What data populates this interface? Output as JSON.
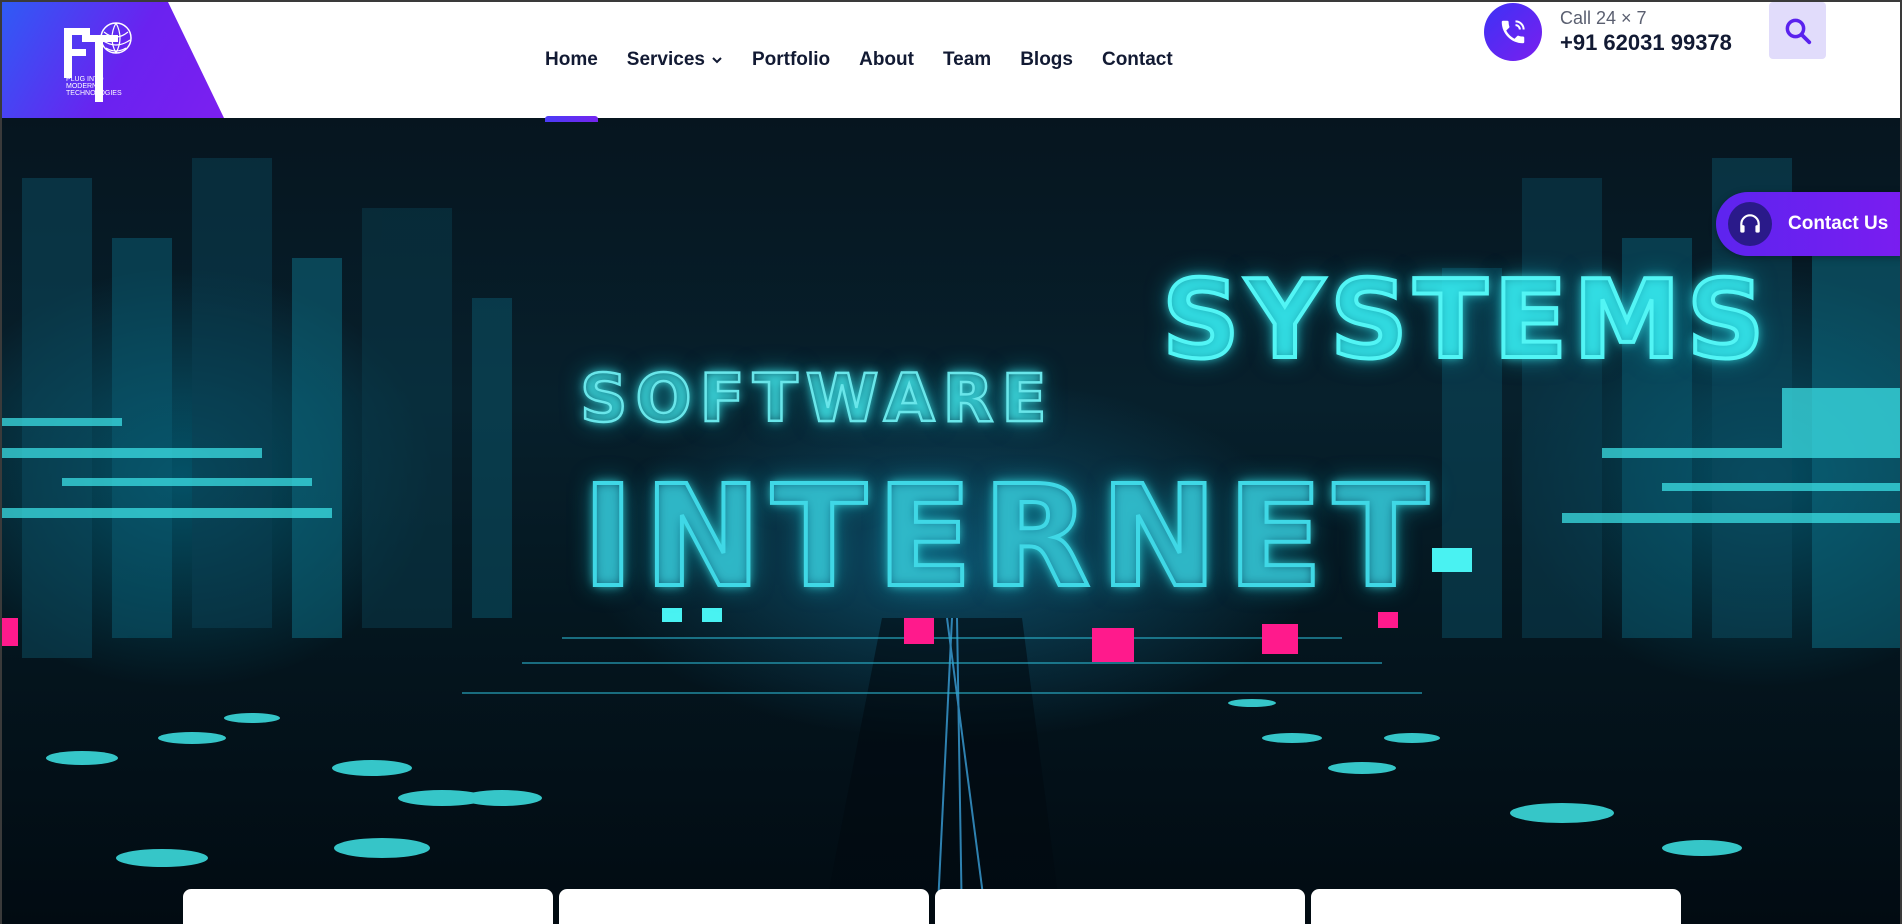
{
  "brand": {
    "logo_letters": "ET",
    "logo_tagline": "PLUG INTO MODERN TECHNOLOGIES",
    "gradient_start": "#2f5bf5",
    "gradient_end": "#7c1ff0"
  },
  "nav": {
    "items": [
      {
        "label": "Home",
        "active": true
      },
      {
        "label": "Services",
        "has_dropdown": true
      },
      {
        "label": "Portfolio"
      },
      {
        "label": "About"
      },
      {
        "label": "Team"
      },
      {
        "label": "Blogs"
      },
      {
        "label": "Contact"
      }
    ]
  },
  "call": {
    "label": "Call 24 × 7",
    "number": "+91 62031 99378",
    "icon": "phone-icon"
  },
  "search": {
    "icon": "search-icon",
    "bg": "#e1dcfb"
  },
  "hero": {
    "words": [
      "SOFTWARE",
      "SYSTEMS",
      "INTERNET"
    ],
    "glow_color": "#49f2f2",
    "accent_pink": "#ff1a8c"
  },
  "contact_float": {
    "label": "Contact Us",
    "icon": "headphones-icon"
  },
  "cards": {
    "count": 4
  }
}
